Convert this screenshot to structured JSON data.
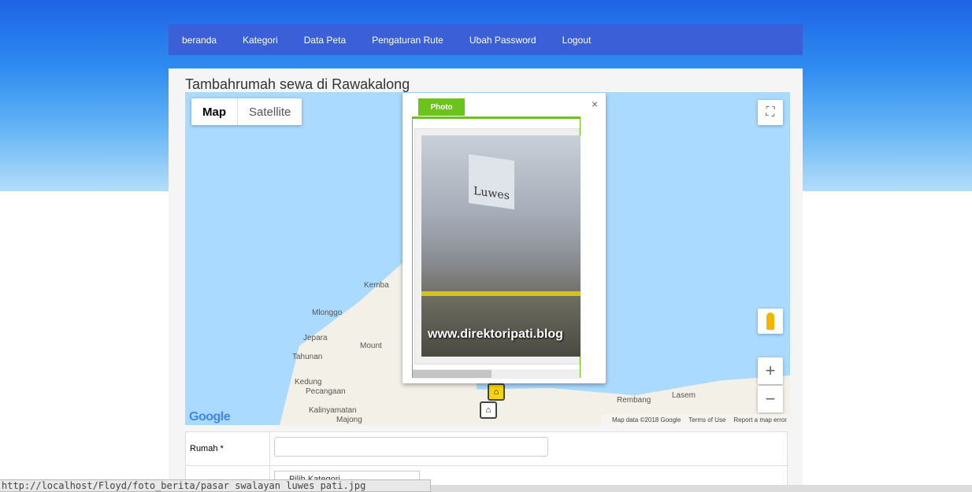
{
  "navbar": {
    "items": [
      "beranda",
      "Kategori",
      "Data Peta",
      "Pengaturan Rute",
      "Ubah Password",
      "Logout"
    ]
  },
  "page": {
    "title": "Tambahrumah sewa di Rawakalong"
  },
  "map": {
    "type_options": {
      "map": "Map",
      "satellite": "Satellite"
    },
    "places": {
      "kemba": "Kemba",
      "mlonggo": "Mlonggo",
      "jepara": "Jepara",
      "mount": "Mount",
      "tahunan": "Tahunan",
      "kedung": "Kedung",
      "pecangaan": "Pecangaan",
      "kalinyamatan": "Kalinyamatan",
      "majong": "Majong",
      "rembang": "Rembang",
      "lasem": "Lasem"
    },
    "footer": {
      "map_data": "Map data ©2018 Google",
      "terms": "Terms of Use",
      "report": "Report a map error"
    },
    "google_logo": "Google",
    "zoom_in": "+",
    "zoom_out": "−"
  },
  "infowindow": {
    "close": "×",
    "tab_label": "Photo",
    "photo_sign": "Luwes",
    "photo_watermark": "www.direktoripati.blog"
  },
  "form": {
    "rumah_label": "Rumah *",
    "rumah_value": "",
    "kategori_select": "Pilih Kategori"
  },
  "status_url": "http://localhost/Floyd/foto_berita/pasar swalayan luwes pati.jpg",
  "colors": {
    "navbar": "#3b5fd6",
    "tab_accent": "#6ac41c",
    "sea": "#aadaff"
  }
}
